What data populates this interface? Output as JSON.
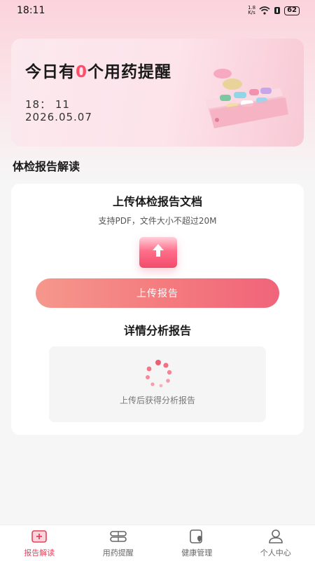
{
  "status_bar": {
    "time": "18:11",
    "net_speed_value": "1.8",
    "net_speed_unit": "K/s",
    "battery": "62"
  },
  "banner": {
    "title_prefix": "今日有",
    "count": "0",
    "title_suffix": "个用药提醒",
    "time": "18： 11",
    "date": "2026.05.07"
  },
  "section": {
    "title": "体检报告解读"
  },
  "upload": {
    "title": "上传体检报告文档",
    "hint": "支持PDF，文件大小不超过20M",
    "button_label": "上传报告"
  },
  "analysis": {
    "title": "详情分析报告",
    "placeholder": "上传后获得分析报告"
  },
  "tabbar": {
    "items": [
      {
        "label": "报告解读",
        "icon": "report-icon",
        "active": true
      },
      {
        "label": "用药提醒",
        "icon": "pill-icon",
        "active": false
      },
      {
        "label": "健康管理",
        "icon": "health-icon",
        "active": false
      },
      {
        "label": "个人中心",
        "icon": "user-icon",
        "active": false
      }
    ]
  },
  "colors": {
    "accent": "#e8405c",
    "button_start": "#f5978c",
    "button_end": "#f0647a",
    "highlight": "#ff4d6a"
  }
}
